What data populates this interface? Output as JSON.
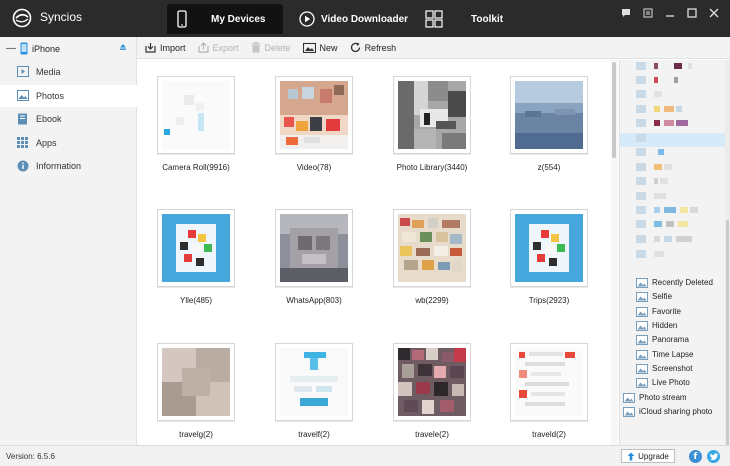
{
  "app": {
    "name": "Syncios"
  },
  "nav": {
    "tabs": [
      {
        "label": "My Devices",
        "icon": "phone-icon",
        "active": true
      },
      {
        "label": "Video Downloader",
        "icon": "play-icon",
        "active": false
      },
      {
        "label": "Toolkit",
        "icon": "toolkit-grid-icon",
        "active": false
      }
    ]
  },
  "device": {
    "name": "iPhone"
  },
  "sidebar": {
    "items": [
      {
        "label": "Media",
        "icon": "media-icon"
      },
      {
        "label": "Photos",
        "icon": "photos-icon",
        "active": true
      },
      {
        "label": "Ebook",
        "icon": "ebook-icon"
      },
      {
        "label": "Apps",
        "icon": "apps-icon"
      },
      {
        "label": "Information",
        "icon": "info-icon"
      }
    ]
  },
  "toolbar": {
    "import": "Import",
    "export": "Export",
    "delete": "Delete",
    "new": "New",
    "refresh": "Refresh"
  },
  "albums": [
    {
      "label": "Camera Roll(9916)"
    },
    {
      "label": "Video(78)"
    },
    {
      "label": "Photo Library(3440)"
    },
    {
      "label": "z(554)"
    },
    {
      "label": "Ylle(485)"
    },
    {
      "label": "WhatsApp(803)"
    },
    {
      "label": "wb(2299)"
    },
    {
      "label": "Trips(2923)"
    },
    {
      "label": "travelg(2)"
    },
    {
      "label": "travelf(2)"
    },
    {
      "label": "travele(2)"
    },
    {
      "label": "traveld(2)"
    }
  ],
  "right_panel": {
    "items": [
      {
        "label": "Recently Deleted"
      },
      {
        "label": "Selfie"
      },
      {
        "label": "Favorite"
      },
      {
        "label": "Hidden"
      },
      {
        "label": "Panorama"
      },
      {
        "label": "Time Lapse"
      },
      {
        "label": "Screenshot"
      },
      {
        "label": "Live Photo"
      },
      {
        "label": "Photo stream"
      },
      {
        "label": "iCloud sharing photo"
      }
    ]
  },
  "status": {
    "version": "Version: 6.5.6",
    "upgrade": "Upgrade"
  },
  "colors": {
    "titlebar": "#2b2b2b",
    "active_tab": "#121212",
    "accent_blue": "#2a8fd8",
    "facebook": "#3b8fd4",
    "twitter": "#39a9e6"
  }
}
